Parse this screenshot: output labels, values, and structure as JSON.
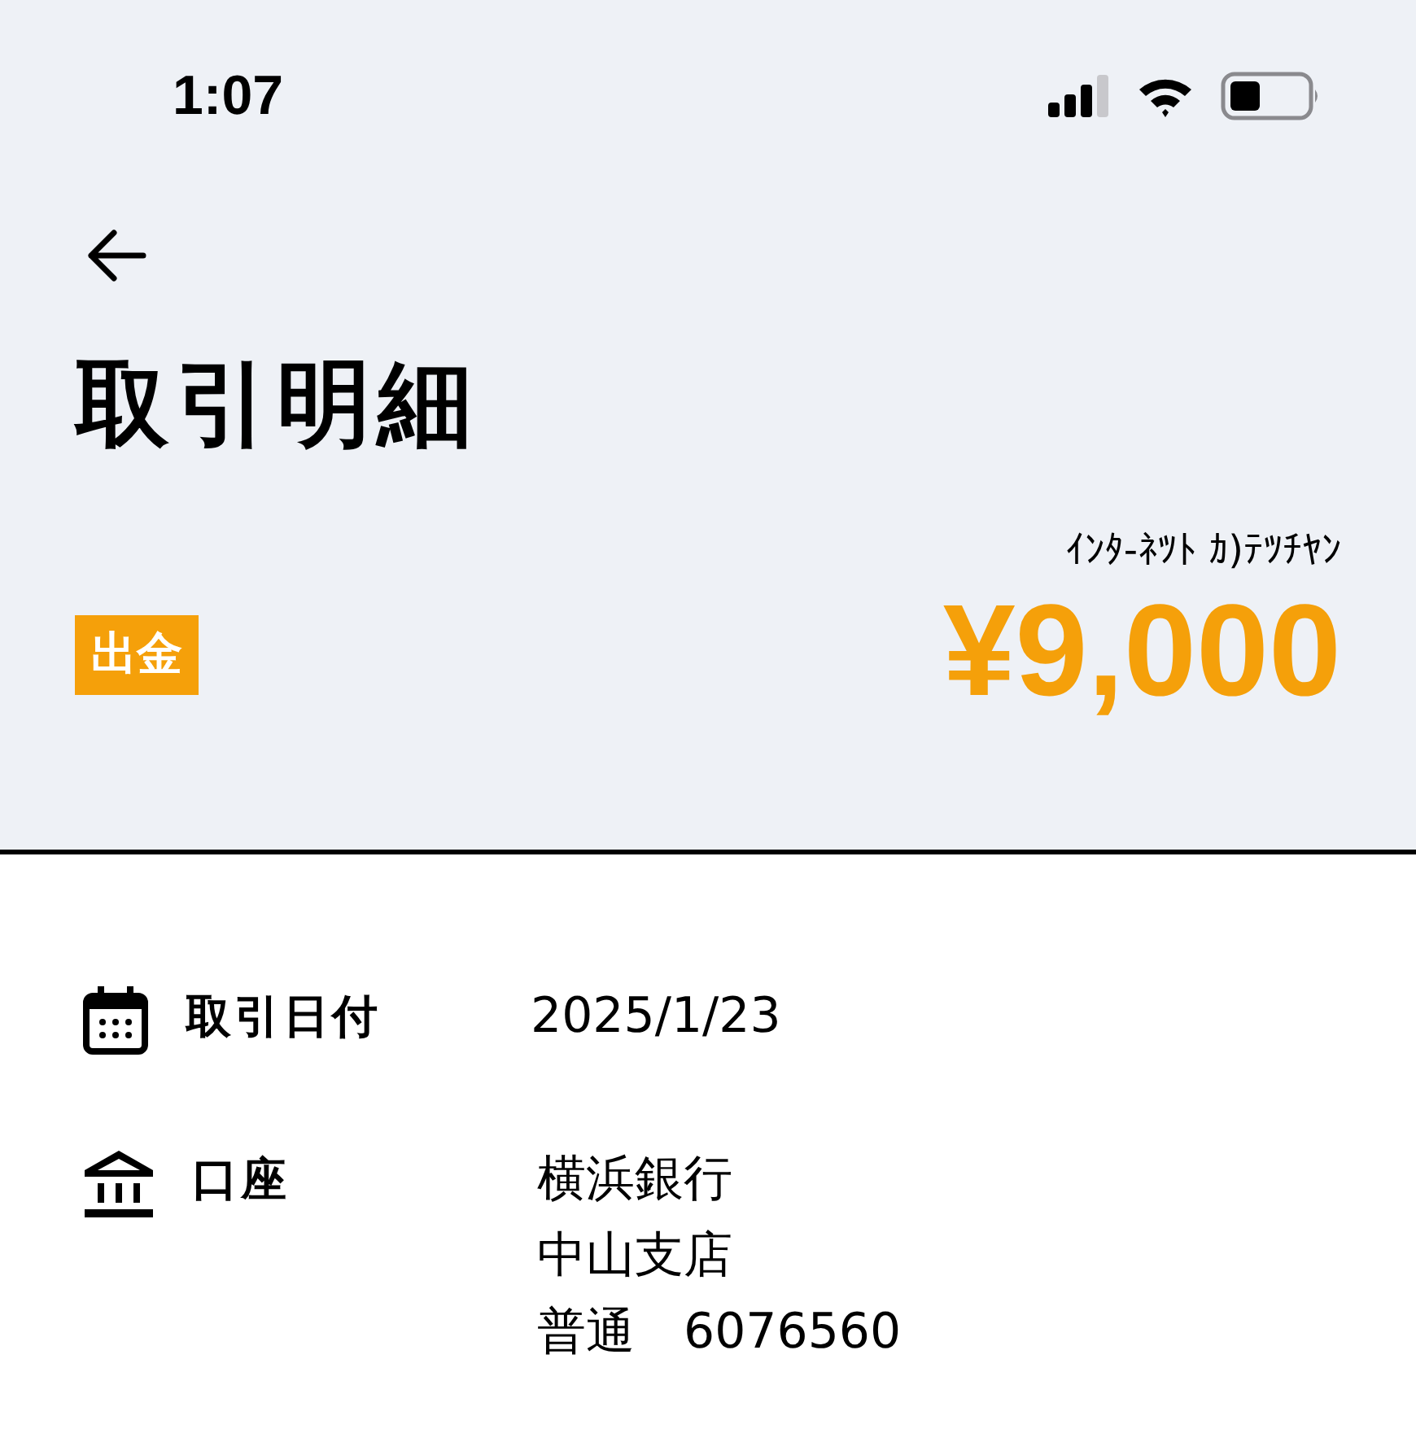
{
  "status_bar": {
    "time": "1:07"
  },
  "title": "取引明細",
  "transaction": {
    "payee": "ｲﾝﾀ-ﾈﾂﾄ ｶ)ﾃﾂﾁﾔﾝ",
    "kind": "withdrawal",
    "type_label": "出金",
    "amount": "¥9,000"
  },
  "details": [
    {
      "kind": "date",
      "label": "取引日付",
      "lines": [
        "2025/1/23"
      ]
    },
    {
      "kind": "account",
      "label": "口座",
      "lines": [
        "横浜銀行",
        "中山支店",
        "普通　6076560"
      ]
    }
  ]
}
